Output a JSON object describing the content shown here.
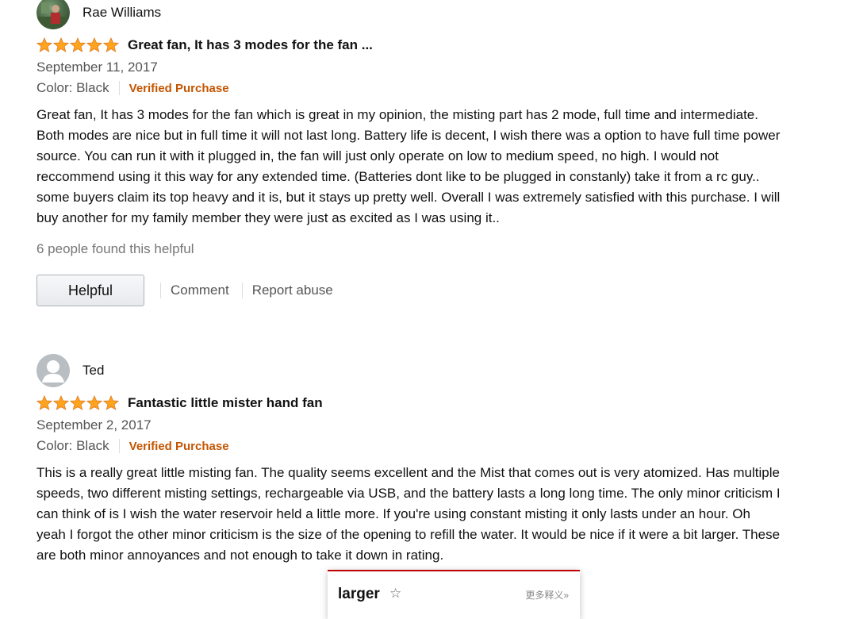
{
  "reviews": [
    {
      "reviewer": "Rae Williams",
      "rating": 5,
      "title": "Great fan, It has 3 modes for the fan ...",
      "date": "September 11, 2017",
      "color": "Color: Black",
      "verified": "Verified Purchase",
      "body": "Great fan, It has 3 modes for the fan which is great in my opinion, the misting part has 2 mode, full time and intermediate. Both modes are nice but in full time it will not last long. Battery life is decent, I wish there was a option to have full time power source. You can run it with it plugged in, the fan will just only operate on low to medium speed, no high. I would not reccommend using it this way for any extended time. (Batteries dont like to be plugged in constanly) take it from a rc guy.. some buyers claim its top heavy and it is, but it stays up pretty well. Overall I was extremely satisfied with this purchase. I will buy another for my family member they were just as excited as I was using it..",
      "helpful_count": "6 people found this helpful",
      "helpful_label": "Helpful",
      "comment_label": "Comment",
      "report_label": "Report abuse",
      "avatar": "user-photo"
    },
    {
      "reviewer": "Ted",
      "rating": 5,
      "title": "Fantastic little mister hand fan",
      "date": "September 2, 2017",
      "color": "Color: Black",
      "verified": "Verified Purchase",
      "body": "This is a really great little misting fan. The quality seems excellent and the Mist that comes out is very atomized. Has multiple speeds, two different misting settings, rechargeable via USB, and the battery lasts a long long time. The only minor criticism I can think of is I wish the water reservoir held a little more. If you're using constant misting it only lasts under an hour. Oh yeah I forgot the other minor criticism is the size of the opening to refill the water. It would be nice if it were a bit larger. These are both minor annoyances and not enough to take it down in rating.",
      "avatar": "default-user-icon"
    }
  ],
  "popup": {
    "word": "larger",
    "star_icon": "star-outline-icon",
    "more_label": "更多释义»"
  },
  "colors": {
    "star": "#ffa41c",
    "verified": "#c45500",
    "popup_accent": "#c00000"
  }
}
